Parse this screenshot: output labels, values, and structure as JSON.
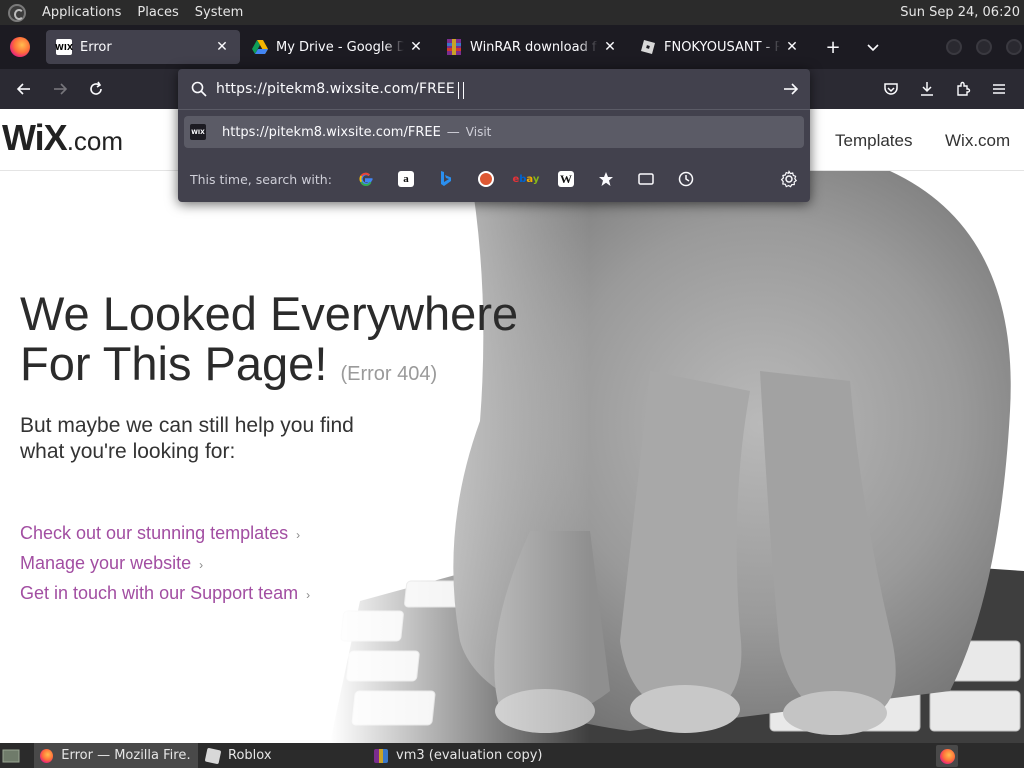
{
  "top_panel": {
    "menus": [
      "Applications",
      "Places",
      "System"
    ],
    "clock": "Sun Sep 24, 06:20"
  },
  "tabs": [
    {
      "title": "Error",
      "icon": "wix-favicon"
    },
    {
      "title": "My Drive - Google Drive",
      "icon": "google-drive-icon"
    },
    {
      "title": "WinRAR download free",
      "icon": "winrar-icon"
    },
    {
      "title": "FNOKYOUSANT - Roblox",
      "icon": "roblox-icon"
    }
  ],
  "urlbar": {
    "value": "https://pitekm8.wixsite.com/FREE",
    "suggestion_url": "https://pitekm8.wixsite.com/FREE",
    "suggestion_action": "Visit",
    "engines_label": "This time, search with:",
    "engines": [
      "google",
      "amazon",
      "bing",
      "duckduckgo",
      "ebay",
      "wikipedia",
      "bookmarks",
      "tabs",
      "history"
    ]
  },
  "page": {
    "logo_big": "WiX",
    "logo_small": ".com",
    "header_links": [
      "Templates",
      "Wix.com"
    ],
    "headline_line1": "We Looked Everywhere",
    "headline_line2": "For This Page!",
    "error_code": "(Error 404)",
    "subtext": "But maybe we can still help you find what you're looking for:",
    "help_links": [
      "Check out our stunning templates",
      "Manage your website",
      "Get in touch with our Support team"
    ],
    "link_color": "#a24ea2"
  },
  "taskbar": {
    "tasks": [
      "Error — Mozilla Fire…",
      "Roblox",
      "vm3 (evaluation copy)"
    ]
  },
  "colors": {
    "panel_bg": "#2b2b2b",
    "tab_bar_bg": "#1c1b22",
    "active_tab_bg": "#42414d",
    "nav_bar_bg": "#2b2a33",
    "popup_bg": "#42414d"
  }
}
